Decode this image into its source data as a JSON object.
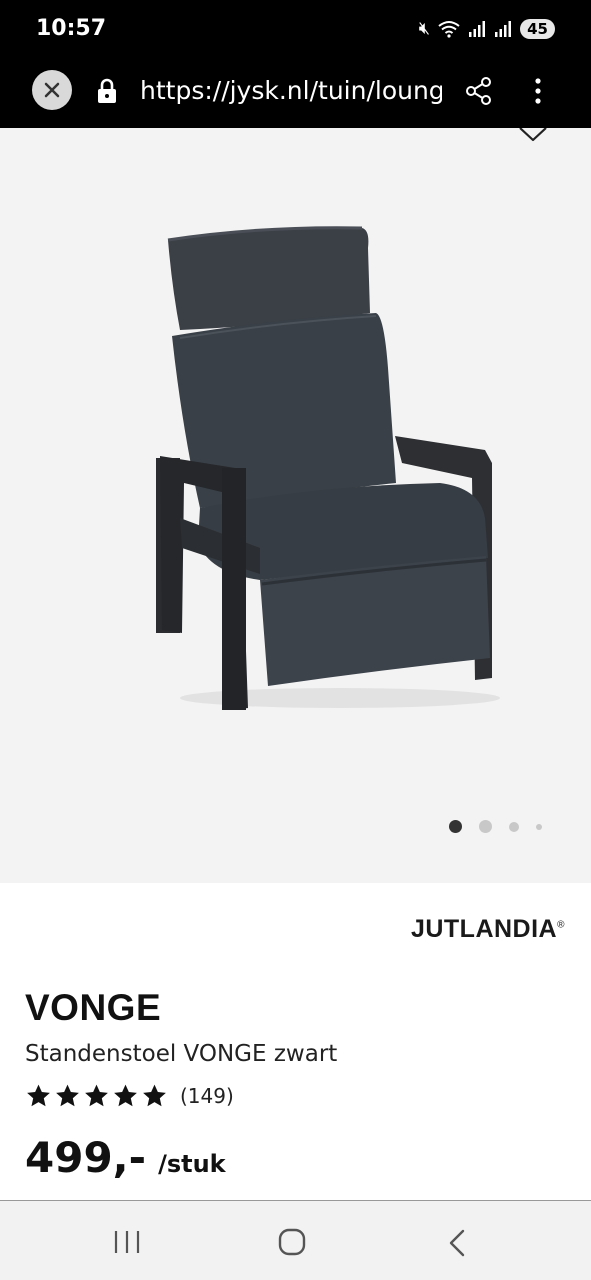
{
  "status_bar": {
    "time": "10:57",
    "icons": [
      "mute-icon",
      "wifi-icon",
      "signal-icon",
      "signal-icon"
    ],
    "battery": "45"
  },
  "browser": {
    "url": "https://jysk.nl/tuin/lounge"
  },
  "gallery": {
    "image_alt": "Standenstoel VONGE zwart",
    "dots_count": 4,
    "active_dot": 0
  },
  "product": {
    "brand": "JUTLANDIA",
    "brand_mark": "®",
    "name": "VONGE",
    "description": "Standenstoel VONGE zwart",
    "rating": 5,
    "rating_count": "(149)",
    "price": "499,-",
    "price_unit": "/stuk"
  },
  "nav": {
    "icons": [
      "recents-icon",
      "home-icon",
      "back-icon"
    ]
  }
}
